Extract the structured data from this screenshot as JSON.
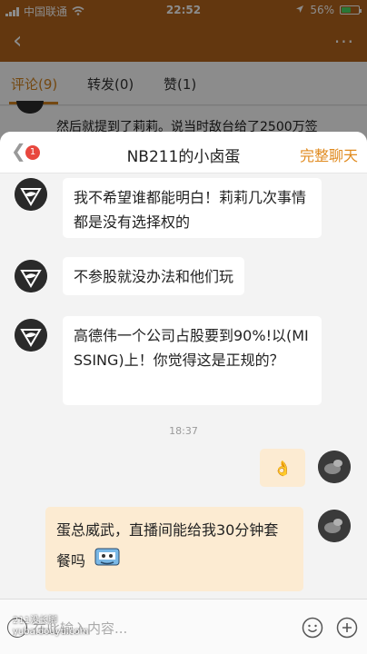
{
  "status_bar": {
    "carrier": "中国联通",
    "time": "22:52",
    "battery": "56%",
    "battery_level": 0.56
  },
  "bg_tabs": [
    {
      "label": "评论(9)",
      "active": true
    },
    {
      "label": "转发(0)",
      "active": false
    },
    {
      "label": "赞(1)",
      "active": false
    }
  ],
  "bg_comment": "然后就提到了莉莉。说当时敌台给了2500万签",
  "chat": {
    "unread_count": "1",
    "title": "NB211的小卤蛋",
    "action_label": "完整聊天",
    "messages": [
      {
        "from": "other",
        "text": "我不希望谁都能明白！莉莉几次事情都是没有选择权的"
      },
      {
        "from": "other",
        "text": "不参股就没办法和他们玩"
      },
      {
        "from": "other",
        "text": "高德伟一个公司占股要到90%!以(MISSING)上！你觉得这是正规的？"
      },
      {
        "from": "me",
        "text": "👌"
      },
      {
        "from": "me",
        "text": "蛋总威武，直播间能给我30分钟套餐吗",
        "sticker": "sticker-icon"
      }
    ],
    "timestamp": "18:37",
    "input_placeholder": "在此输入内容..."
  },
  "watermark": {
    "line1": "211没长脚",
    "line2": "yuba.douyu.com"
  },
  "colors": {
    "accent": "#e08a1e",
    "nav_bg": "#b5651d",
    "my_bubble": "#fcebd2",
    "badge": "#e8473e"
  }
}
